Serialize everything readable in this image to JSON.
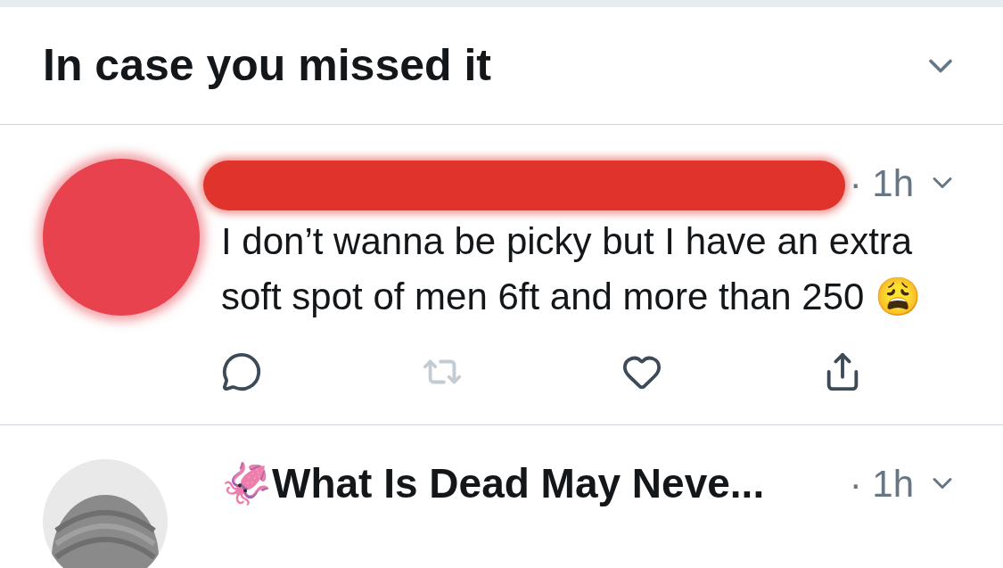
{
  "section": {
    "title": "In case you missed it",
    "expanded": false
  },
  "tweets": [
    {
      "avatar": {
        "kind": "redacted"
      },
      "name_redacted": true,
      "time": "· 1h",
      "text": "I don’t wanna be picky but I have an extra soft spot of men 6ft and more than 250 😩",
      "actions": [
        {
          "kind": "reply",
          "disabled": false
        },
        {
          "kind": "retweet",
          "disabled": true
        },
        {
          "kind": "like",
          "disabled": false
        },
        {
          "kind": "share",
          "disabled": false
        }
      ]
    },
    {
      "name_redacted": false,
      "name": "🦑What Is Dead May Neve...",
      "time": "· 1h"
    }
  ]
}
